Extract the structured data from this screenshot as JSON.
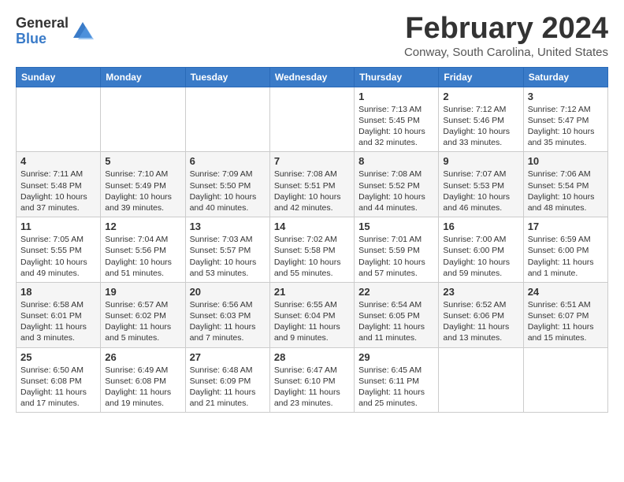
{
  "header": {
    "logo_general": "General",
    "logo_blue": "Blue",
    "month_title": "February 2024",
    "location": "Conway, South Carolina, United States"
  },
  "weekdays": [
    "Sunday",
    "Monday",
    "Tuesday",
    "Wednesday",
    "Thursday",
    "Friday",
    "Saturday"
  ],
  "weeks": [
    [
      {
        "day": "",
        "info": ""
      },
      {
        "day": "",
        "info": ""
      },
      {
        "day": "",
        "info": ""
      },
      {
        "day": "",
        "info": ""
      },
      {
        "day": "1",
        "info": "Sunrise: 7:13 AM\nSunset: 5:45 PM\nDaylight: 10 hours\nand 32 minutes."
      },
      {
        "day": "2",
        "info": "Sunrise: 7:12 AM\nSunset: 5:46 PM\nDaylight: 10 hours\nand 33 minutes."
      },
      {
        "day": "3",
        "info": "Sunrise: 7:12 AM\nSunset: 5:47 PM\nDaylight: 10 hours\nand 35 minutes."
      }
    ],
    [
      {
        "day": "4",
        "info": "Sunrise: 7:11 AM\nSunset: 5:48 PM\nDaylight: 10 hours\nand 37 minutes."
      },
      {
        "day": "5",
        "info": "Sunrise: 7:10 AM\nSunset: 5:49 PM\nDaylight: 10 hours\nand 39 minutes."
      },
      {
        "day": "6",
        "info": "Sunrise: 7:09 AM\nSunset: 5:50 PM\nDaylight: 10 hours\nand 40 minutes."
      },
      {
        "day": "7",
        "info": "Sunrise: 7:08 AM\nSunset: 5:51 PM\nDaylight: 10 hours\nand 42 minutes."
      },
      {
        "day": "8",
        "info": "Sunrise: 7:08 AM\nSunset: 5:52 PM\nDaylight: 10 hours\nand 44 minutes."
      },
      {
        "day": "9",
        "info": "Sunrise: 7:07 AM\nSunset: 5:53 PM\nDaylight: 10 hours\nand 46 minutes."
      },
      {
        "day": "10",
        "info": "Sunrise: 7:06 AM\nSunset: 5:54 PM\nDaylight: 10 hours\nand 48 minutes."
      }
    ],
    [
      {
        "day": "11",
        "info": "Sunrise: 7:05 AM\nSunset: 5:55 PM\nDaylight: 10 hours\nand 49 minutes."
      },
      {
        "day": "12",
        "info": "Sunrise: 7:04 AM\nSunset: 5:56 PM\nDaylight: 10 hours\nand 51 minutes."
      },
      {
        "day": "13",
        "info": "Sunrise: 7:03 AM\nSunset: 5:57 PM\nDaylight: 10 hours\nand 53 minutes."
      },
      {
        "day": "14",
        "info": "Sunrise: 7:02 AM\nSunset: 5:58 PM\nDaylight: 10 hours\nand 55 minutes."
      },
      {
        "day": "15",
        "info": "Sunrise: 7:01 AM\nSunset: 5:59 PM\nDaylight: 10 hours\nand 57 minutes."
      },
      {
        "day": "16",
        "info": "Sunrise: 7:00 AM\nSunset: 6:00 PM\nDaylight: 10 hours\nand 59 minutes."
      },
      {
        "day": "17",
        "info": "Sunrise: 6:59 AM\nSunset: 6:00 PM\nDaylight: 11 hours\nand 1 minute."
      }
    ],
    [
      {
        "day": "18",
        "info": "Sunrise: 6:58 AM\nSunset: 6:01 PM\nDaylight: 11 hours\nand 3 minutes."
      },
      {
        "day": "19",
        "info": "Sunrise: 6:57 AM\nSunset: 6:02 PM\nDaylight: 11 hours\nand 5 minutes."
      },
      {
        "day": "20",
        "info": "Sunrise: 6:56 AM\nSunset: 6:03 PM\nDaylight: 11 hours\nand 7 minutes."
      },
      {
        "day": "21",
        "info": "Sunrise: 6:55 AM\nSunset: 6:04 PM\nDaylight: 11 hours\nand 9 minutes."
      },
      {
        "day": "22",
        "info": "Sunrise: 6:54 AM\nSunset: 6:05 PM\nDaylight: 11 hours\nand 11 minutes."
      },
      {
        "day": "23",
        "info": "Sunrise: 6:52 AM\nSunset: 6:06 PM\nDaylight: 11 hours\nand 13 minutes."
      },
      {
        "day": "24",
        "info": "Sunrise: 6:51 AM\nSunset: 6:07 PM\nDaylight: 11 hours\nand 15 minutes."
      }
    ],
    [
      {
        "day": "25",
        "info": "Sunrise: 6:50 AM\nSunset: 6:08 PM\nDaylight: 11 hours\nand 17 minutes."
      },
      {
        "day": "26",
        "info": "Sunrise: 6:49 AM\nSunset: 6:08 PM\nDaylight: 11 hours\nand 19 minutes."
      },
      {
        "day": "27",
        "info": "Sunrise: 6:48 AM\nSunset: 6:09 PM\nDaylight: 11 hours\nand 21 minutes."
      },
      {
        "day": "28",
        "info": "Sunrise: 6:47 AM\nSunset: 6:10 PM\nDaylight: 11 hours\nand 23 minutes."
      },
      {
        "day": "29",
        "info": "Sunrise: 6:45 AM\nSunset: 6:11 PM\nDaylight: 11 hours\nand 25 minutes."
      },
      {
        "day": "",
        "info": ""
      },
      {
        "day": "",
        "info": ""
      }
    ]
  ]
}
